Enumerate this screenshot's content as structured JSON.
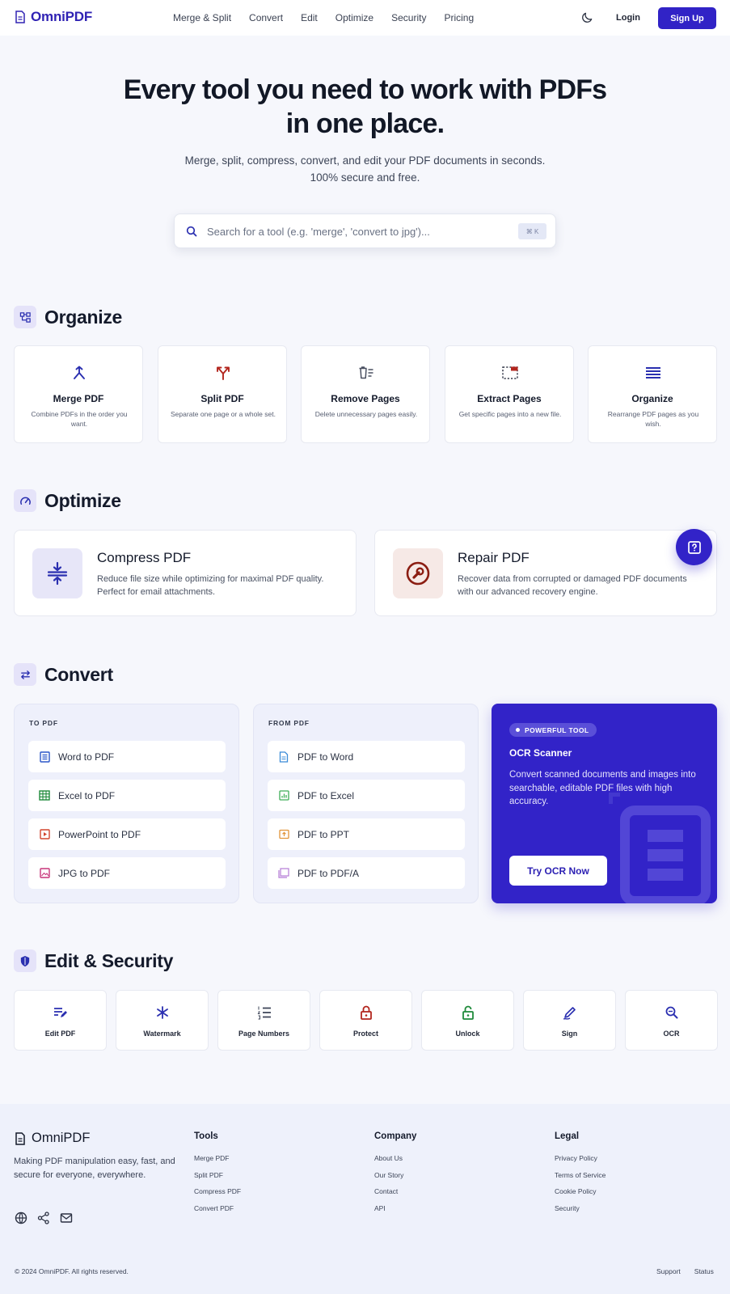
{
  "nav": {
    "brand": "OmniPDF",
    "links": [
      "Merge & Split",
      "Convert",
      "Edit",
      "Optimize",
      "Security",
      "Pricing"
    ],
    "login": "Login",
    "signup": "Sign Up"
  },
  "hero": {
    "title_line1": "Every tool you need to work with PDFs",
    "title_line2": "in one place.",
    "subtitle_line1": "Merge, split, compress, convert, and edit your PDF documents in seconds.",
    "subtitle_line2": "100% secure and free.",
    "search_placeholder": "Search for a tool (e.g. 'merge', 'convert to jpg')...",
    "search_shortcut": "⌘ K"
  },
  "organize": {
    "title": "Organize",
    "cards": [
      {
        "title": "Merge PDF",
        "desc": "Combine PDFs in the order you want.",
        "icon": "merge-icon",
        "color": "#2a2fb0"
      },
      {
        "title": "Split PDF",
        "desc": "Separate one page or a whole set.",
        "icon": "split-icon",
        "color": "#b3261e"
      },
      {
        "title": "Remove Pages",
        "desc": "Delete unnecessary pages easily.",
        "icon": "remove-pages-icon",
        "color": "#4a5061"
      },
      {
        "title": "Extract Pages",
        "desc": "Get specific pages into a new file.",
        "icon": "extract-pages-icon",
        "color": "#b3261e"
      },
      {
        "title": "Organize",
        "desc": "Rearrange PDF pages as you wish.",
        "icon": "organize-list-icon",
        "color": "#2a2fb0"
      }
    ]
  },
  "optimize": {
    "title": "Optimize",
    "cards": [
      {
        "title": "Compress PDF",
        "desc": "Reduce file size while optimizing for maximal PDF quality. Perfect for email attachments.",
        "icon": "compress-icon",
        "color": "#2a2fb0",
        "bg": "#e7e6f8"
      },
      {
        "title": "Repair PDF",
        "desc": "Recover data from corrupted or damaged PDF documents with our advanced recovery engine.",
        "icon": "wrench-icon",
        "color": "#8b1d12",
        "bg": "#f6e9e6"
      }
    ]
  },
  "convert": {
    "title": "Convert",
    "to_pdf": {
      "label": "TO PDF",
      "items": [
        {
          "label": "Word to PDF",
          "icon": "word-doc-icon",
          "color": "#2b56c8"
        },
        {
          "label": "Excel to PDF",
          "icon": "excel-sheet-icon",
          "color": "#1f8a3b"
        },
        {
          "label": "PowerPoint to PDF",
          "icon": "powerpoint-icon",
          "color": "#d2452d"
        },
        {
          "label": "JPG to PDF",
          "icon": "image-icon",
          "color": "#c7357a"
        }
      ]
    },
    "from_pdf": {
      "label": "FROM PDF",
      "items": [
        {
          "label": "PDF to Word",
          "icon": "word-doc-icon",
          "color": "#3a8bd8"
        },
        {
          "label": "PDF to Excel",
          "icon": "excel-sheet-icon",
          "color": "#3fae58"
        },
        {
          "label": "PDF to PPT",
          "icon": "powerpoint-icon",
          "color": "#e2953a"
        },
        {
          "label": "PDF to PDF/A",
          "icon": "archive-icon",
          "color": "#b37bd6"
        }
      ]
    },
    "ocr": {
      "badge": "POWERFUL TOOL",
      "title": "OCR Scanner",
      "desc": "Convert scanned documents and images into searchable, editable PDF files with high accuracy.",
      "button": "Try OCR Now"
    }
  },
  "edit_security": {
    "title": "Edit & Security",
    "items": [
      {
        "label": "Edit PDF",
        "icon": "edit-icon",
        "color": "#2a2fb0"
      },
      {
        "label": "Watermark",
        "icon": "watermark-icon",
        "color": "#2a2fb0"
      },
      {
        "label": "Page Numbers",
        "icon": "page-numbers-icon",
        "color": "#3c4457"
      },
      {
        "label": "Protect",
        "icon": "lock-icon",
        "color": "#b3261e"
      },
      {
        "label": "Unlock",
        "icon": "unlock-icon",
        "color": "#1f8a3b"
      },
      {
        "label": "Sign",
        "icon": "sign-icon",
        "color": "#2a2fb0"
      },
      {
        "label": "OCR",
        "icon": "ocr-search-icon",
        "color": "#2a2fb0"
      }
    ]
  },
  "footer": {
    "brand": "OmniPDF",
    "desc": "Making PDF manipulation easy, fast, and secure for everyone, everywhere.",
    "columns": [
      {
        "title": "Tools",
        "links": [
          "Merge PDF",
          "Split PDF",
          "Compress PDF",
          "Convert PDF"
        ]
      },
      {
        "title": "Company",
        "links": [
          "About Us",
          "Our Story",
          "Contact",
          "API"
        ]
      },
      {
        "title": "Legal",
        "links": [
          "Privacy Policy",
          "Terms of Service",
          "Cookie Policy",
          "Security"
        ]
      }
    ],
    "copyright": "© 2024 OmniPDF. All rights reserved.",
    "bottom_links": [
      "Support",
      "Status"
    ]
  },
  "colors": {
    "primary": "#3123c6",
    "background": "#f6f7fc",
    "text": "#141a2b"
  }
}
